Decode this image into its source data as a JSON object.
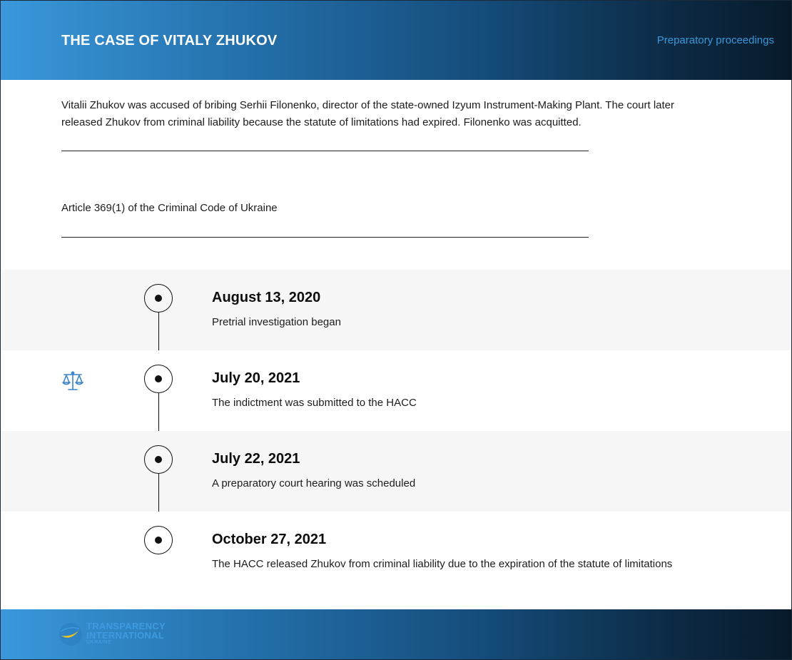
{
  "header": {
    "title": "THE CASE OF VITALY ZHUKOV",
    "stage": "Preparatory proceedings"
  },
  "summary": "Vitalii Zhukov was accused of bribing Serhii Filonenko, director of the state-owned Izyum Instrument-Making Plant. The court later released Zhukov from criminal liability because the statute of limitations had expired. Filonenko was acquitted.",
  "article": "Article 369(1) of the Criminal Code of Ukraine",
  "timeline": [
    {
      "date": "August 13, 2020",
      "description": "Pretrial investigation began"
    },
    {
      "date": "July 20, 2021",
      "description": "The indictment was submitted to the HACC",
      "icon": "scales-icon"
    },
    {
      "date": "July 22, 2021",
      "description": "A preparatory court hearing was scheduled"
    },
    {
      "date": "October 27, 2021",
      "description": "The HACC released Zhukov from criminal liability due to the expiration of the statute of limitations"
    }
  ],
  "footer": {
    "logo_line1": "TRANSPARENCY",
    "logo_line2": "INTERNATIONAL",
    "logo_line3": "UKRAINE"
  },
  "colors": {
    "accent_blue": "#3a98db",
    "header_dark": "#071a2b",
    "logo_yellow": "#f5c518"
  }
}
